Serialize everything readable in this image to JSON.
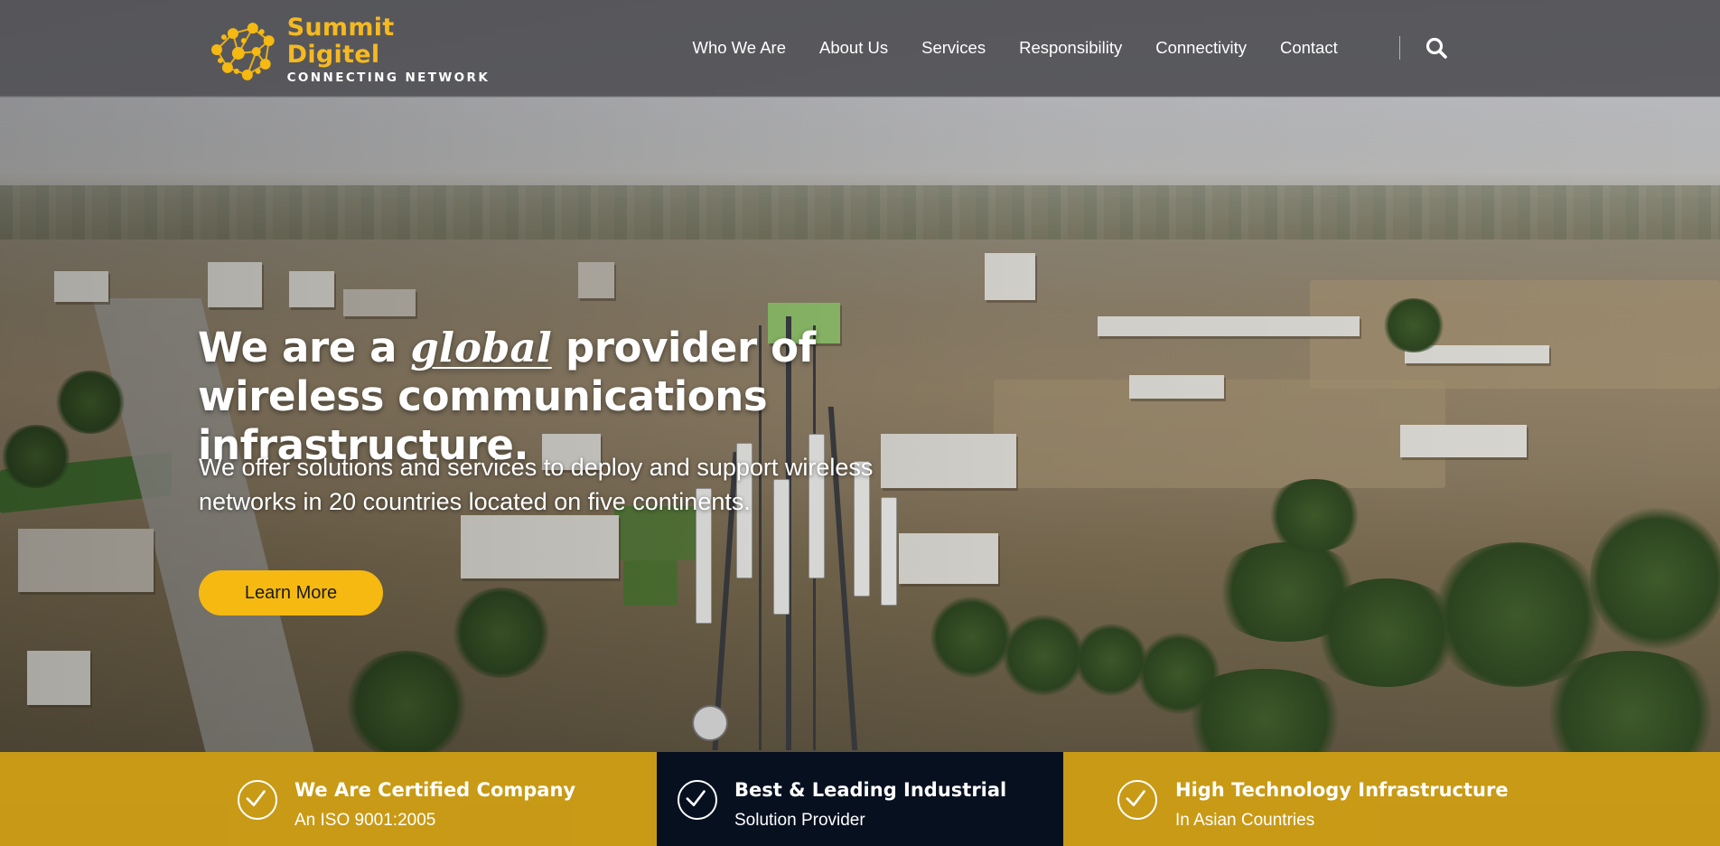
{
  "brand": {
    "name": "Summit Digitel",
    "tagline": "CONNECTING NETWORK",
    "colors": {
      "accent": "#f5b912",
      "dark": "#06101f",
      "header_bg": "#545458"
    }
  },
  "nav": {
    "items": [
      {
        "label": "Who We Are"
      },
      {
        "label": "About Us"
      },
      {
        "label": "Services"
      },
      {
        "label": "Responsibility"
      },
      {
        "label": "Connectivity"
      },
      {
        "label": "Contact"
      }
    ],
    "search_icon": "search-icon"
  },
  "hero": {
    "headline_pre": "We are a",
    "headline_accent": "global",
    "headline_post": "provider of wireless communications infrastructure.",
    "subtext": "We offer solutions and services to deploy and support wireless networks in 20 countries located on five continents.",
    "cta_label": "Learn More"
  },
  "features": [
    {
      "icon": "check-circle-icon",
      "title": "We Are Certified Company",
      "subtitle": "An ISO 9001:2005"
    },
    {
      "icon": "check-circle-icon",
      "title": "Best & Leading Industrial",
      "subtitle": "Solution Provider"
    },
    {
      "icon": "check-circle-icon",
      "title": "High Technology Infrastructure",
      "subtitle": "In Asian Countries"
    }
  ]
}
